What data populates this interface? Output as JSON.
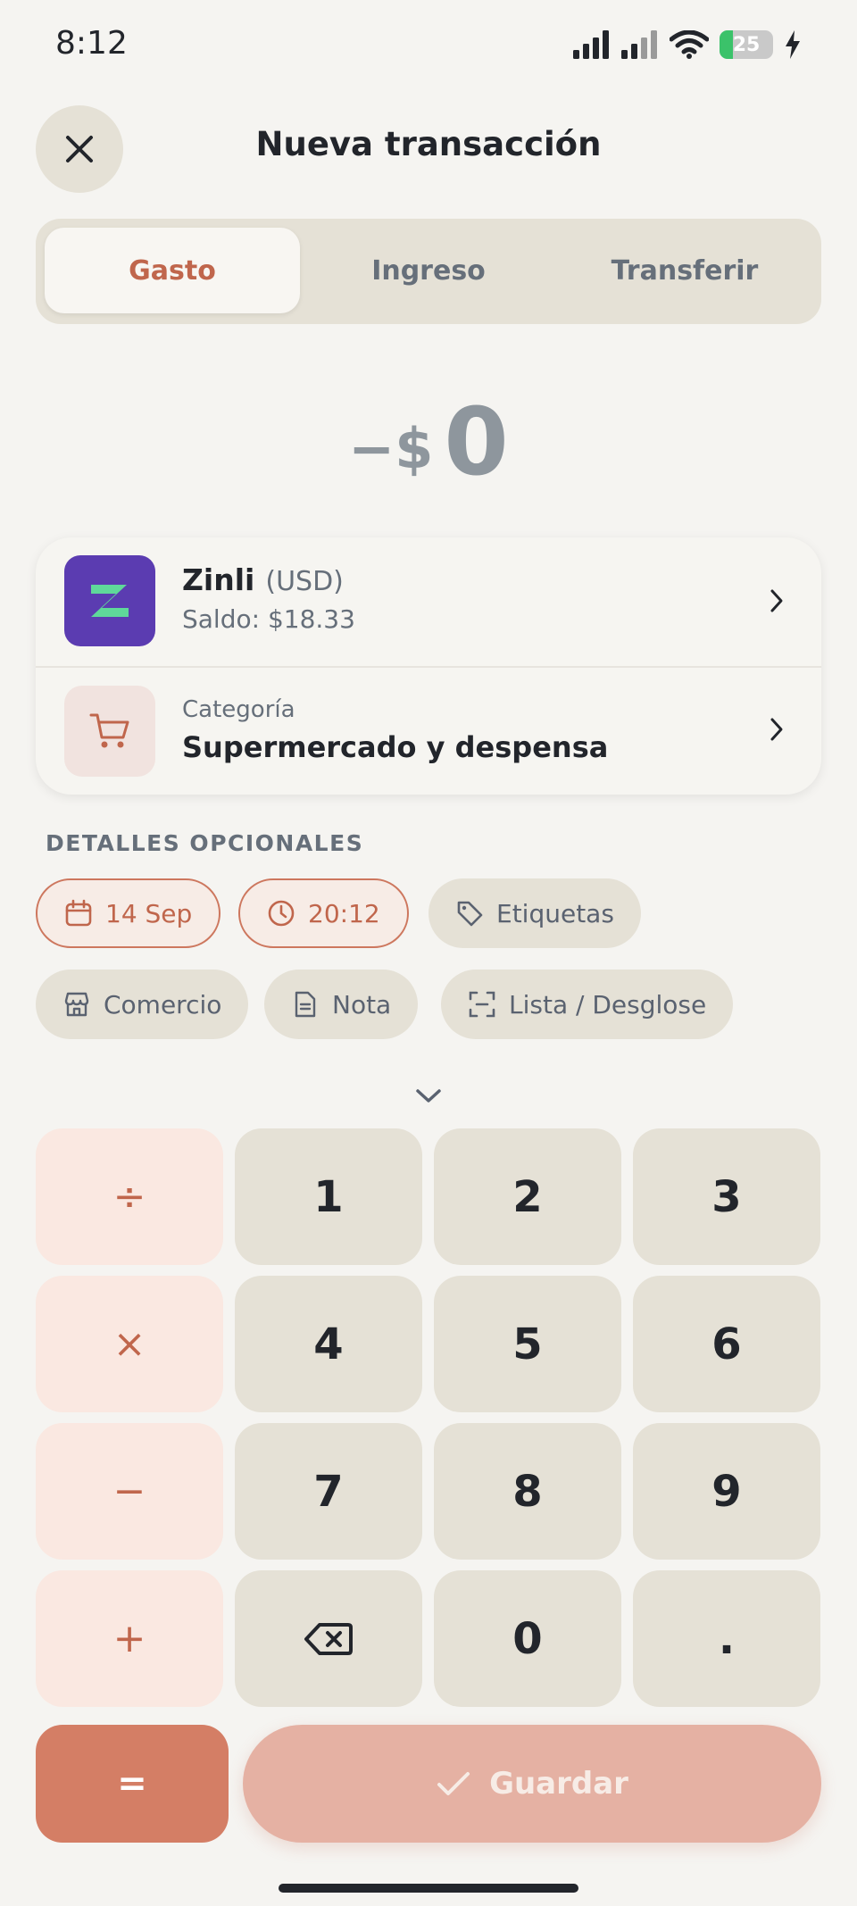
{
  "status_bar": {
    "time": "8:12",
    "battery": "25"
  },
  "header": {
    "title": "Nueva transacción"
  },
  "tabs": [
    {
      "label": "Gasto",
      "active": true
    },
    {
      "label": "Ingreso",
      "active": false
    },
    {
      "label": "Transferir",
      "active": false
    }
  ],
  "amount": {
    "prefix": "−$",
    "value": "0"
  },
  "account": {
    "logo_letter": "Z",
    "name": "Zinli",
    "currency": "(USD)",
    "balance": "Saldo: $18.33"
  },
  "category": {
    "label": "Categoría",
    "value": "Supermercado y despensa",
    "icon": "cart-icon"
  },
  "optional": {
    "section_label": "DETALLES OPCIONALES",
    "chips": [
      {
        "label": "14 Sep",
        "icon": "calendar-icon"
      },
      {
        "label": "20:12",
        "icon": "clock-icon"
      },
      {
        "label": "Etiquetas",
        "icon": "tag-icon"
      },
      {
        "label": "Comercio",
        "icon": "store-icon"
      },
      {
        "label": "Nota",
        "icon": "note-icon"
      },
      {
        "label": "Lista / Desglose",
        "icon": "scan-icon"
      }
    ]
  },
  "keypad": {
    "ops": [
      "÷",
      "×",
      "−",
      "+"
    ],
    "numbers": [
      "1",
      "2",
      "3",
      "4",
      "5",
      "6",
      "7",
      "8",
      "9",
      "0",
      "."
    ],
    "equals": "=",
    "save": "Guardar"
  },
  "colors": {
    "accent": "#c0664c",
    "zinli_purple": "#5b3cb1",
    "zinli_green": "#5fd89a",
    "background": "#f5f4f1"
  }
}
